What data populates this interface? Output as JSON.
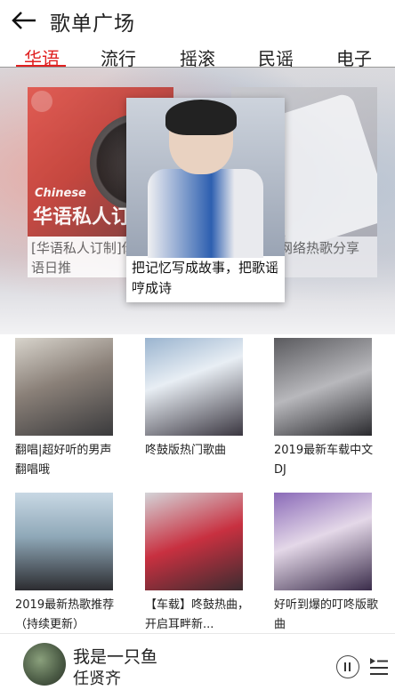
{
  "header": {
    "title": "歌单广场",
    "back_icon": "back-arrow-icon"
  },
  "tabs": [
    {
      "label": "华语",
      "active": true
    },
    {
      "label": "流行",
      "active": false
    },
    {
      "label": "摇滚",
      "active": false
    },
    {
      "label": "民谣",
      "active": false
    },
    {
      "label": "电子",
      "active": false
    }
  ],
  "colors": {
    "accent": "#e02020",
    "text": "#222222",
    "background": "#ffffff"
  },
  "carousel": {
    "left": {
      "en": "Chinese",
      "zh": "华语私人订",
      "caption": "[华语私人订制]你的华语日推"
    },
    "center": {
      "caption": "把记忆写成故事，把歌谣哼成诗"
    },
    "right": {
      "caption": "网络热歌分享"
    }
  },
  "playlists": [
    {
      "name": "翻唱|超好听的男声翻唱哦"
    },
    {
      "name": "咚鼓版热门歌曲"
    },
    {
      "name": "2019最新车载中文DJ"
    },
    {
      "name": "2019最新热歌推荐（持续更新）"
    },
    {
      "name": "【车载】咚鼓热曲，开启耳畔新..."
    },
    {
      "name": "好听到爆的叮咚版歌曲"
    }
  ],
  "player": {
    "song": "我是一只鱼",
    "artist": "任贤齐",
    "playing": true
  }
}
